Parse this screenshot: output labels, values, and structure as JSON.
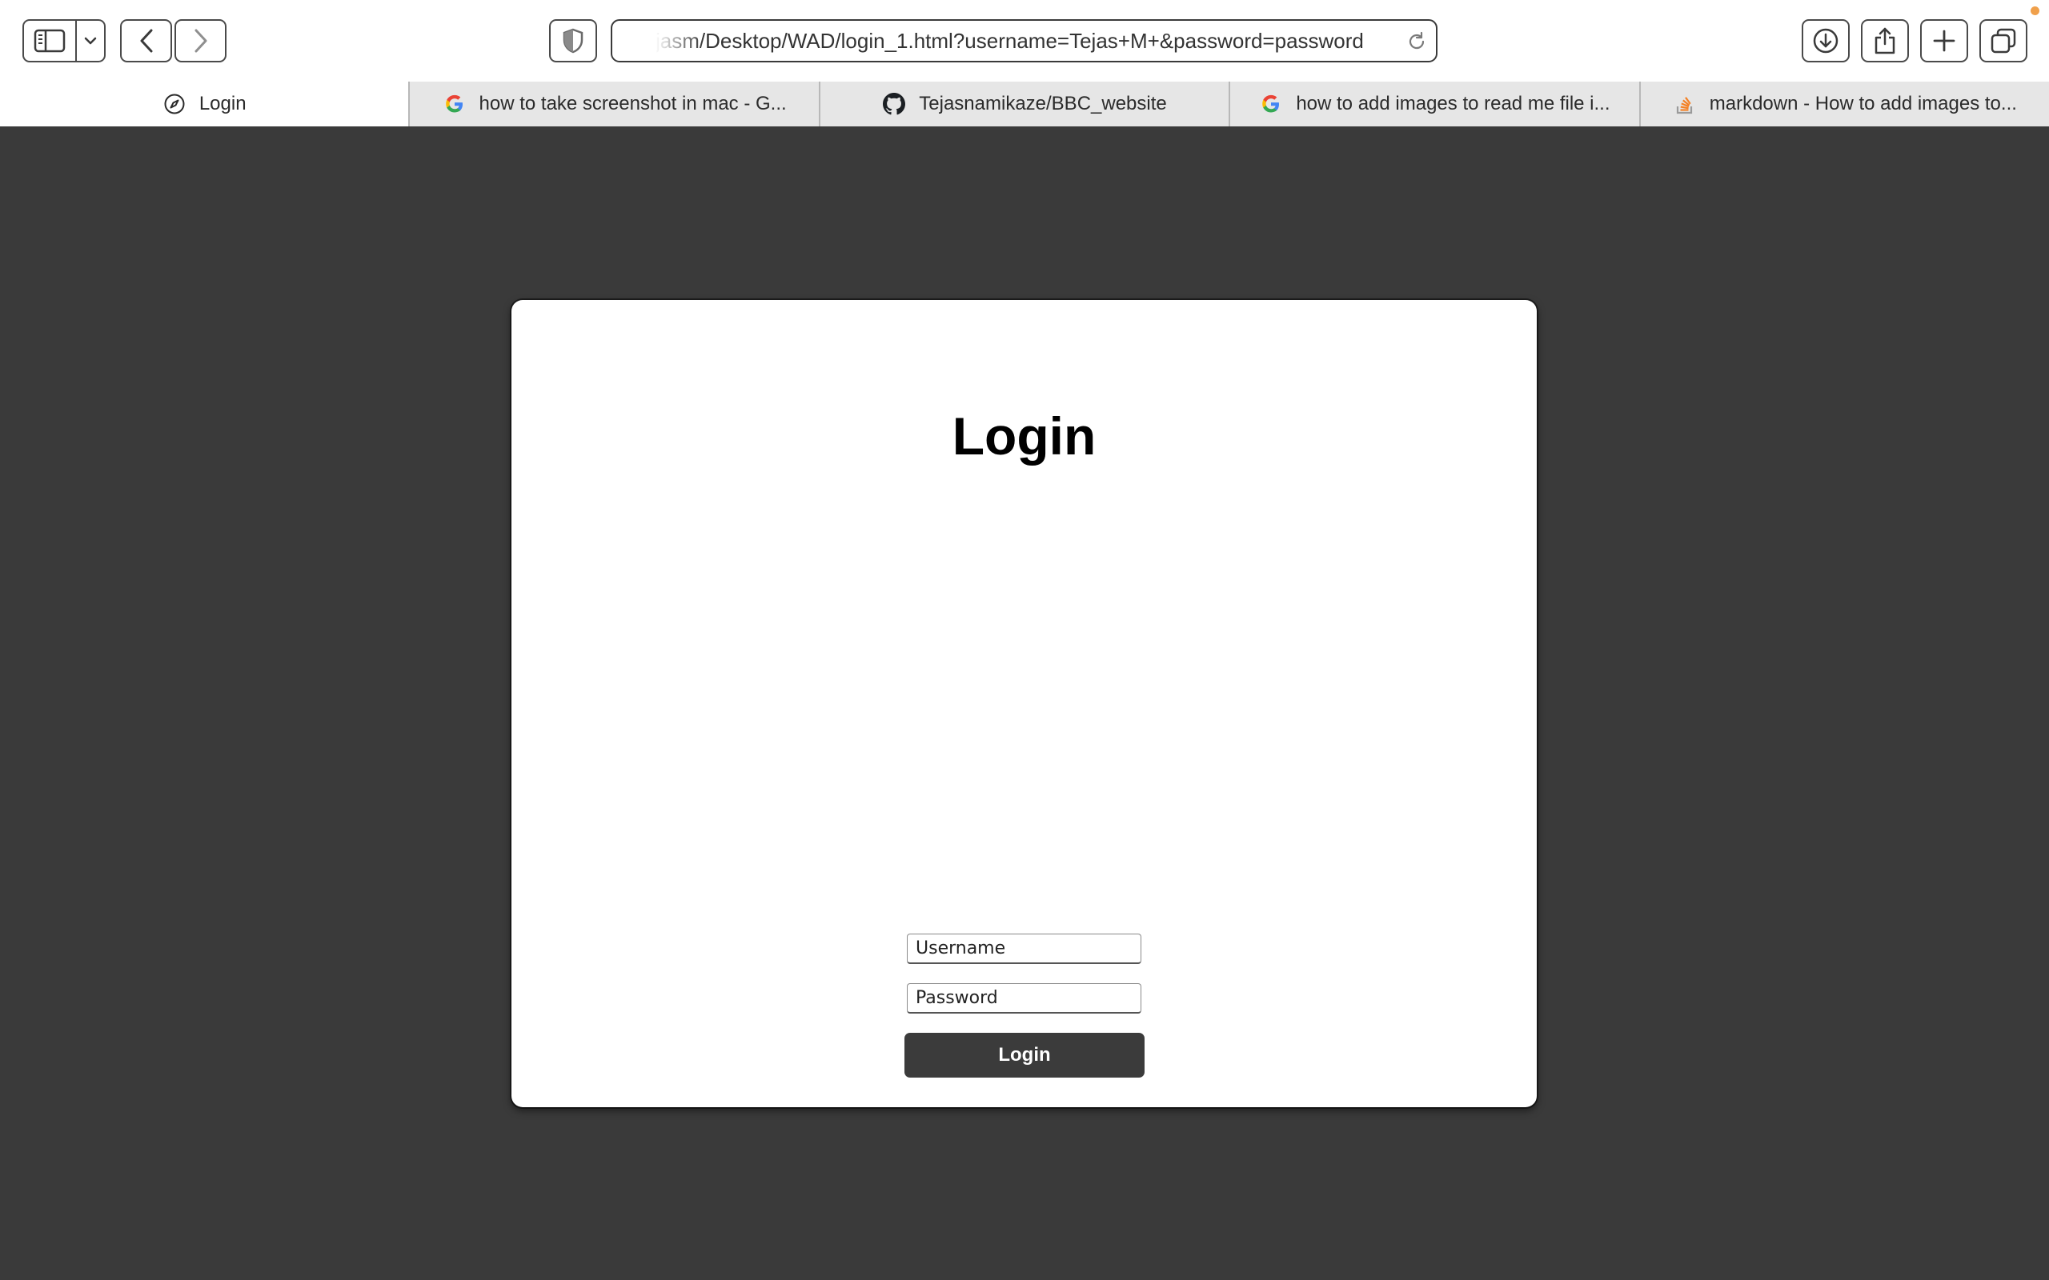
{
  "browser": {
    "url": "jasm/Desktop/WAD/login_1.html?username=Tejas+M+&password=password",
    "tabs": [
      {
        "label": "Login",
        "icon": "compass-icon",
        "active": true
      },
      {
        "label": "how to take screenshot in mac - G...",
        "icon": "google-icon",
        "active": false
      },
      {
        "label": "Tejasnamikaze/BBC_website",
        "icon": "github-icon",
        "active": false
      },
      {
        "label": "how to add images to read me file i...",
        "icon": "google-icon",
        "active": false
      },
      {
        "label": "markdown - How to add images to...",
        "icon": "stackoverflow-icon",
        "active": false
      }
    ],
    "colors": {
      "page_background": "#3a3a3a",
      "card_background": "#ffffff",
      "button_background": "#3b3b3b",
      "notification_dot": "#f0a04b"
    }
  },
  "page": {
    "title": "Login",
    "username_placeholder": "Username",
    "password_placeholder": "Password",
    "login_button": "Login"
  }
}
